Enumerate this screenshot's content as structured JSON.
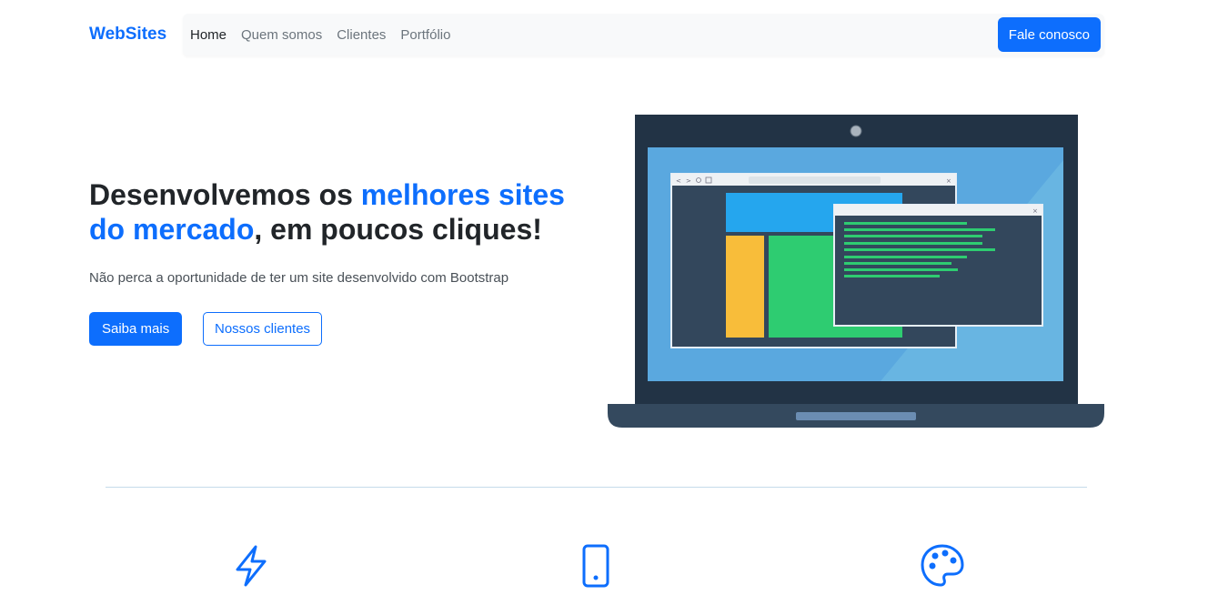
{
  "brand": "WebSites",
  "nav": {
    "items": [
      {
        "label": "Home",
        "active": true
      },
      {
        "label": "Quem somos",
        "active": false
      },
      {
        "label": "Clientes",
        "active": false
      },
      {
        "label": "Portfólio",
        "active": false
      }
    ],
    "cta_label": "Fale conosco"
  },
  "hero": {
    "title_part1": "Desenvolvemos os ",
    "title_highlight": "melhores sites do mercado",
    "title_part2": ", em poucos cliques!",
    "subtitle": "Não perca a oportunidade de ter um site desenvolvido com Bootstrap",
    "primary_button": "Saiba mais",
    "secondary_button": "Nossos clientes"
  },
  "features": {
    "icons": [
      "lightning-icon",
      "phone-icon",
      "palette-icon"
    ]
  },
  "colors": {
    "accent": "#0d6efd",
    "nav_bg": "#f8f9fa"
  }
}
